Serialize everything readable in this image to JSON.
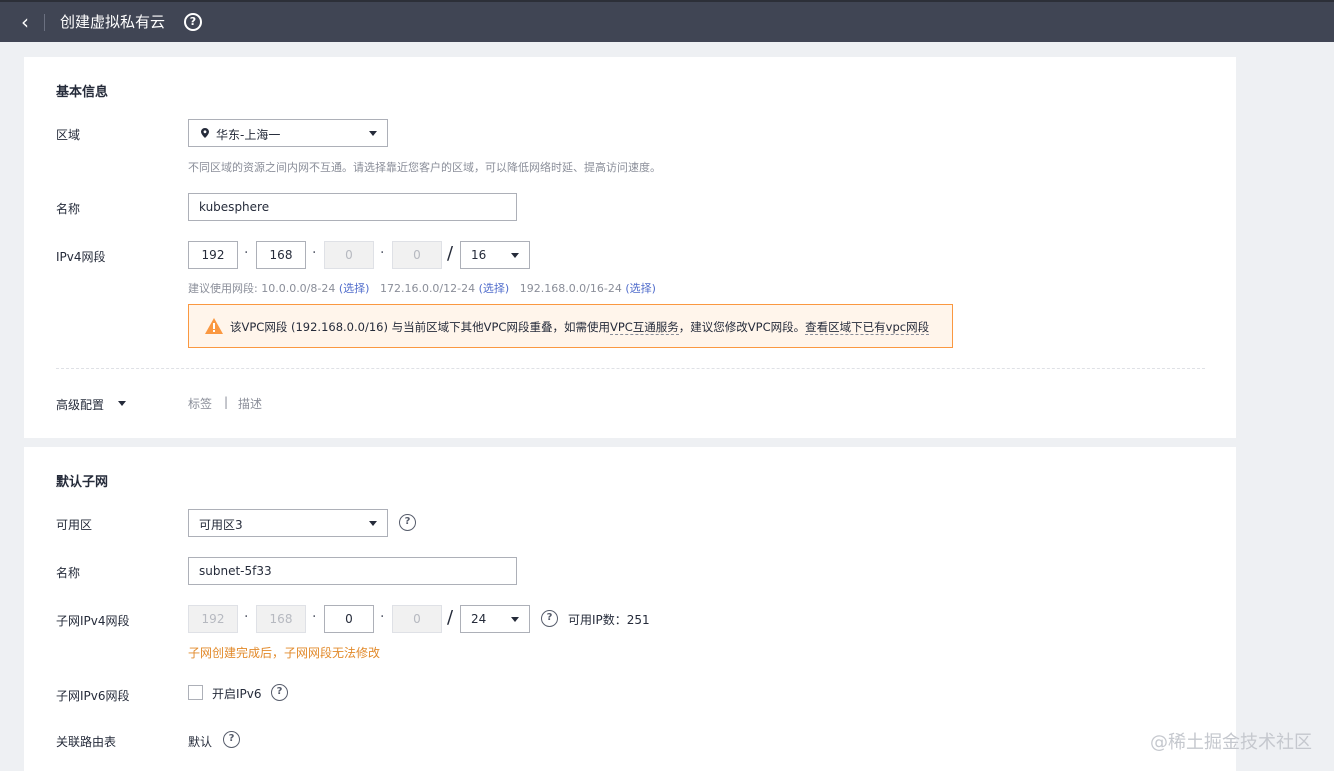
{
  "header": {
    "title": "创建虚拟私有云",
    "back_icon": "chevron-left-icon",
    "help_icon": "question-circle-icon"
  },
  "basic": {
    "section_title": "基本信息",
    "region": {
      "label": "区域",
      "value": "华东-上海一",
      "hint": "不同区域的资源之间内网不互通。请选择靠近您客户的区域，可以降低网络时延、提高访问速度。"
    },
    "name": {
      "label": "名称",
      "value": "kubesphere"
    },
    "ipv4": {
      "label": "IPv4网段",
      "octets": [
        "192",
        "168",
        "0",
        "0"
      ],
      "mask": "16",
      "suggest_prefix": "建议使用网段: 10.0.0.0/8-24",
      "suggest_1_link": "(选择)",
      "suggest_2": "172.16.0.0/12-24",
      "suggest_2_link": "(选择)",
      "suggest_3": "192.168.0.0/16-24",
      "suggest_3_link": "(选择)"
    },
    "warning": {
      "part1": "该VPC网段 (192.168.0.0/16) 与当前区域下其他VPC网段重叠，如需使用",
      "link1": "VPC互通服务",
      "part2": "，建议您修改VPC网段。",
      "link2": "查看区域下已有vpc网段",
      "color": "#fa9841"
    },
    "advanced": {
      "label": "高级配置",
      "tag": "标签",
      "sep": "|",
      "desc": "描述"
    }
  },
  "subnet": {
    "section_title": "默认子网",
    "az": {
      "label": "可用区",
      "value": "可用区3"
    },
    "name": {
      "label": "名称",
      "value": "subnet-5f33"
    },
    "ipv4": {
      "label": "子网IPv4网段",
      "octets": [
        "192",
        "168",
        "0",
        "0"
      ],
      "mask": "24",
      "available": "可用IP数：251",
      "note": "子网创建完成后，子网网段无法修改"
    },
    "ipv6": {
      "label": "子网IPv6网段",
      "checkbox_label": "开启IPv6"
    },
    "route": {
      "label": "关联路由表",
      "value": "默认"
    }
  },
  "watermark": "@稀土掘金技术社区"
}
